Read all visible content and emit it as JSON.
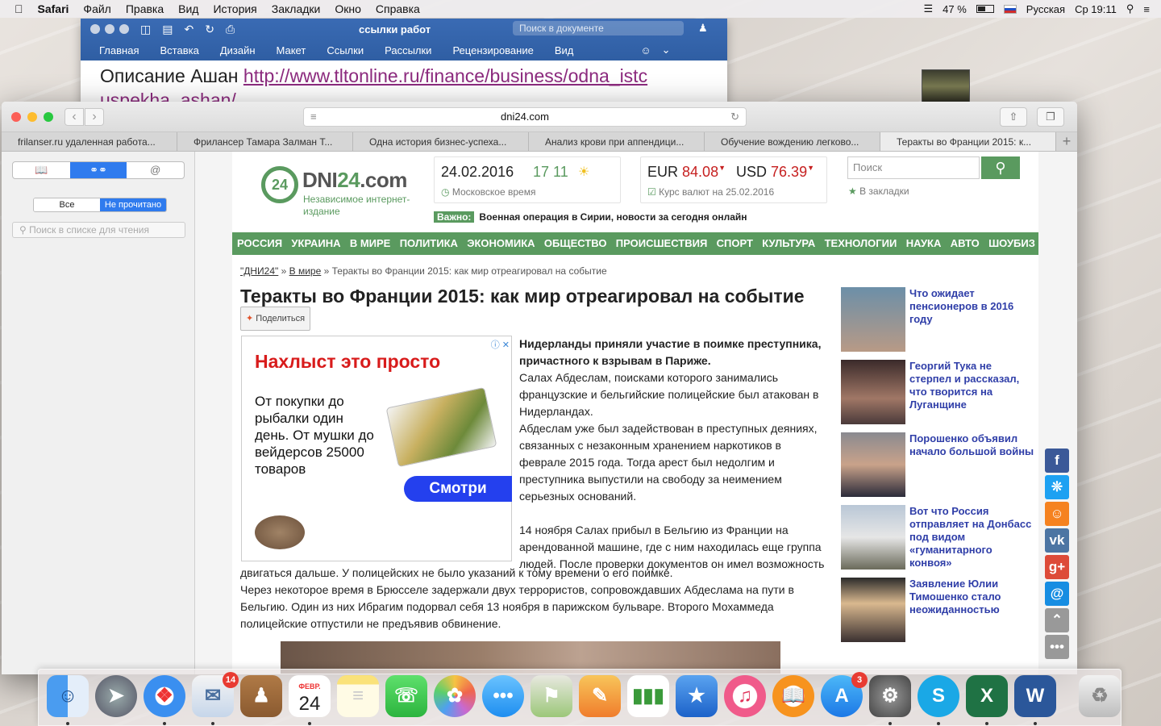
{
  "menubar": {
    "app": "Safari",
    "items": [
      "Файл",
      "Правка",
      "Вид",
      "История",
      "Закладки",
      "Окно",
      "Справка"
    ],
    "battery": "47 %",
    "language": "Русская",
    "clock": "Ср 19:11"
  },
  "word": {
    "title": "ссылки работ",
    "search_placeholder": "Поиск в документе",
    "ribbon": [
      "Главная",
      "Вставка",
      "Дизайн",
      "Макет",
      "Ссылки",
      "Рассылки",
      "Рецензирование",
      "Вид"
    ],
    "doc_label": "Описание Ашан",
    "doc_link": "http://www.tltonline.ru/finance/business/odna_istc",
    "doc_link2": "uspekha_ashan/"
  },
  "safari": {
    "url": "dni24.com",
    "tabs": [
      "frilanser.ru удаленная работа...",
      "Фрилансер Тамара Залман Т...",
      "Одна история бизнес-успеха...",
      "Анализ крови при аппендици...",
      "Обучение вождению легково...",
      "Теракты во Франции 2015: к..."
    ],
    "sidebar": {
      "seg_all": "Все",
      "seg_unread": "Не прочитано",
      "search_placeholder": "Поиск в списке для чтения"
    }
  },
  "site": {
    "logo": {
      "name_a": "DNI",
      "name_b": "24",
      "name_c": ".com",
      "circle": "24",
      "tagline": "Независимое интернет-издание"
    },
    "date": "24.02.2016",
    "temp": "17  11",
    "timezone": "Московское время",
    "eur_label": "EUR",
    "eur": "84.08",
    "usd_label": "USD",
    "usd": "76.39",
    "rates_date": "Курс валют на 25.02.2016",
    "search_placeholder": "Поиск",
    "bookmarks": "В закладки",
    "important_label": "Важно:",
    "important_text": "Военная операция в Сирии, новости за сегодня онлайн",
    "nav": [
      "РОССИЯ",
      "УКРАИНА",
      "В МИРЕ",
      "ПОЛИТИКА",
      "ЭКОНОМИКА",
      "ОБЩЕСТВО",
      "ПРОИСШЕСТВИЯ",
      "СПОРТ",
      "КУЛЬТУРА",
      "ТЕХНОЛОГИИ",
      "НАУКА",
      "АВТО",
      "ШОУБИЗ"
    ],
    "crumb1": "\"ДНИ24\"",
    "crumb2": "В мире",
    "crumb3": "Теракты во Франции 2015: как мир отреагировал на событие",
    "headline": "Теракты во Франции 2015: как мир отреагировал на событие",
    "share": "Поделиться",
    "ad": {
      "title": "Нахлыст это просто",
      "desc": "От покупки до рыбалки один день. От мушки до вейдерсов 25000 товаров",
      "button": "Смотри"
    },
    "article_lead": "Нидерланды приняли участие в поимке преступника, причастного к взрывам в Париже.",
    "article_p1": "Салах Абдеслам, поисками которого занимались французские и бельгийские полицейские был атакован в Нидерландах.",
    "article_p2": "Абдеслам уже был задействован в преступных деяниях, связанных с незаконным хранением наркотиков в феврале 2015 года. Тогда арест был недолгим и преступника выпустили на свободу за неимением серьезных оснований.",
    "article_p3": "14 ноября Салах прибыл в Бельгию из Франции на арендованной машине, где с ним находилась еще группа людей. После проверки документов он имел возможность",
    "article_p3b": "двигаться дальше. У полицейских не было указаний к тому времени о его поимке.",
    "article_p4": "Через некоторое время в Брюсселе задержали двух террористов, сопровождавших Абдеслама на пути в Бельгию. Один из них Ибрагим подорвал себя 13 ноября в парижском бульваре. Второго Мохаммеда полицейские отпустили не предъявив обвинение.",
    "side_news": [
      "Что ожидает пенсионеров в 2016 году",
      "Георгий Тука не стерпел и рассказал, что творится на Луганщине",
      "Порошенко объявил начало большой войны",
      "Вот что Россия отправляет на Донбасс под видом «гуманитарного конвоя»",
      "Заявление Юлии Тимошенко стало неожиданностью"
    ]
  },
  "dock": {
    "mail_badge": "14",
    "calendar_month": "ФЕВР.",
    "calendar_day": "24",
    "appstore_badge": "3"
  },
  "colors": {
    "site_green": "#5a9a5f",
    "link_blue": "#2f3ea8",
    "ad_red": "#d81b1b",
    "word_blue": "#2f5ea3"
  }
}
